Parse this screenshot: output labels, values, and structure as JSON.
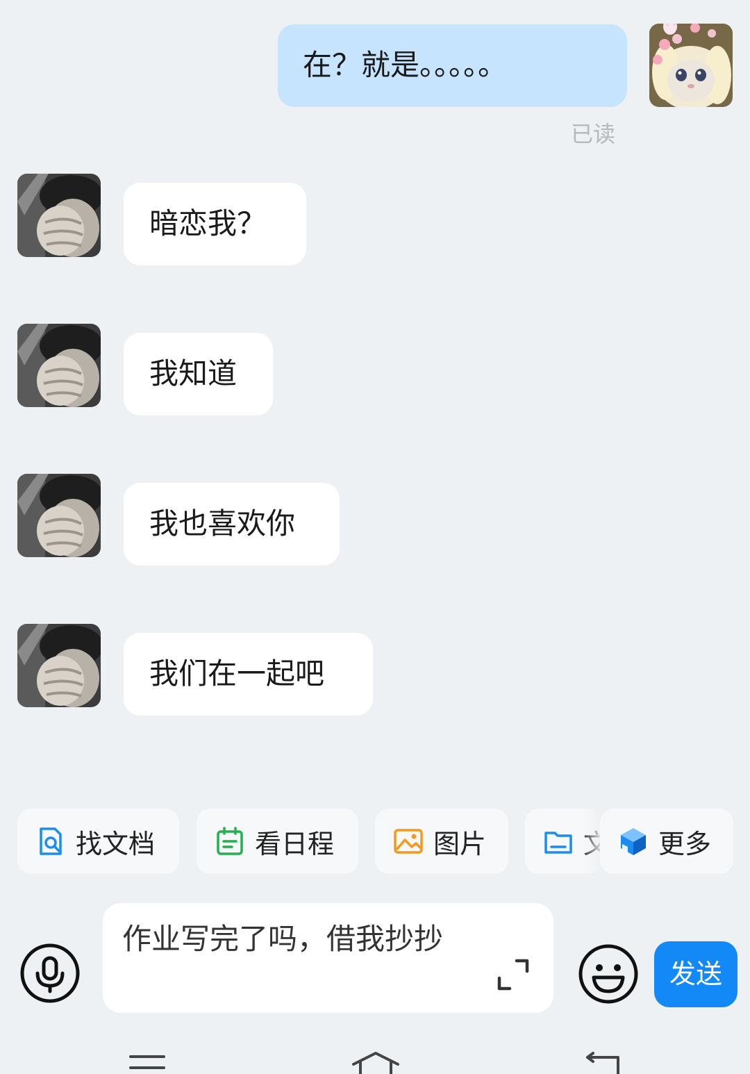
{
  "messages": [
    {
      "sender": "me",
      "text": "在？就是。。。。。",
      "receipt": "已读"
    },
    {
      "sender": "them",
      "text": "暗恋我？"
    },
    {
      "sender": "them",
      "text": "我知道"
    },
    {
      "sender": "them",
      "text": "我也喜欢你"
    },
    {
      "sender": "them",
      "text": "我们在一起吧"
    }
  ],
  "quick_actions": [
    {
      "label": "找文档",
      "icon": "doc-search-icon",
      "color": "#1b8cf2"
    },
    {
      "label": "看日程",
      "icon": "calendar-icon",
      "color": "#22b14c"
    },
    {
      "label": "图片",
      "icon": "image-icon",
      "color": "#f39a1c"
    },
    {
      "label": "文件",
      "icon": "folder-icon",
      "color": "#1b8cf2"
    },
    {
      "label": "更多",
      "icon": "more-cube-icon",
      "color": "#1b8cf2"
    }
  ],
  "composer": {
    "draft": "作业写完了吗，借我抄抄",
    "send_label": "发送"
  },
  "colors": {
    "background": "#eef1f3",
    "my_bubble": "#c6e4fd",
    "their_bubble": "#ffffff",
    "send_button": "#1289f7"
  }
}
